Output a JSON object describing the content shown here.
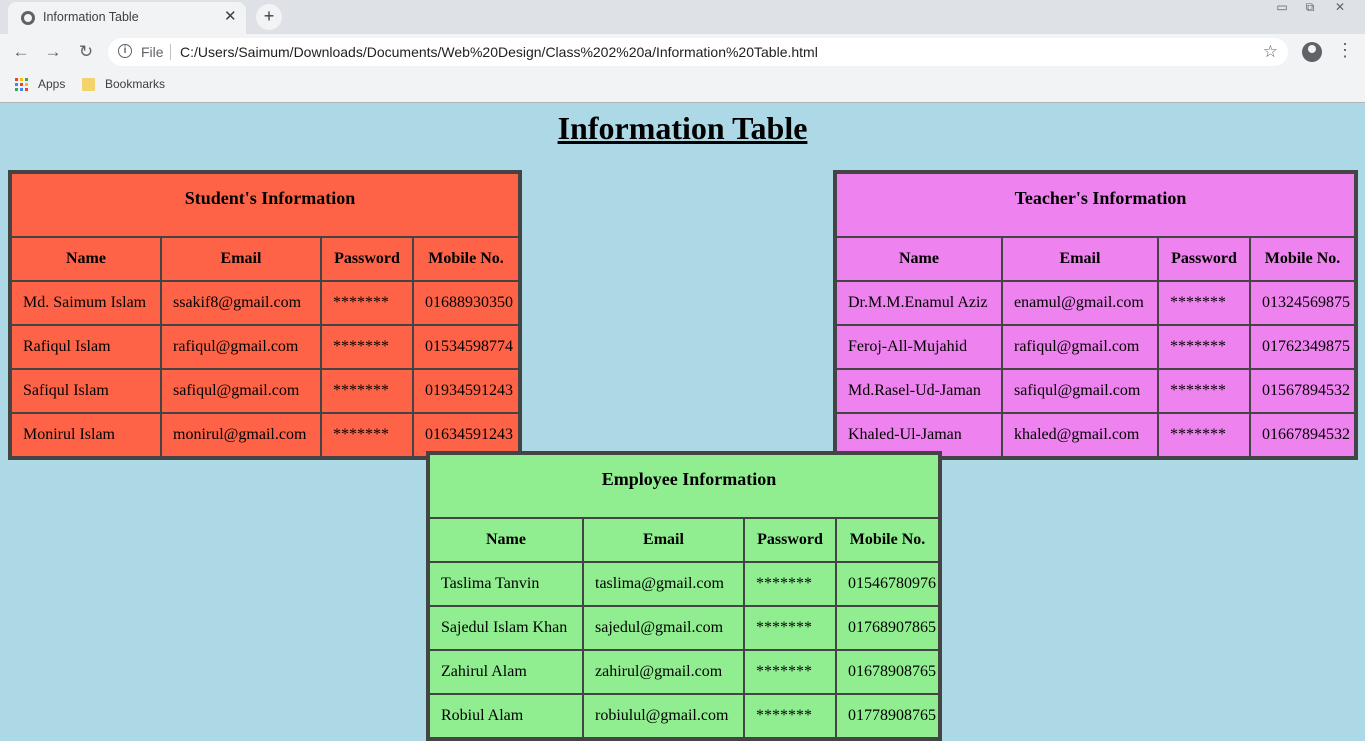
{
  "browser": {
    "tab_title": "Information Table",
    "tab_close": "✕",
    "new_tab": "+",
    "omnibox_scheme": "File",
    "url": "C:/Users/Saimum/Downloads/Documents/Web%20Design/Class%202%20a/Information%20Table.html",
    "bookmarks": [
      "Apps",
      "Bookmarks"
    ]
  },
  "page": {
    "title": "Information Table"
  },
  "headers": [
    "Name",
    "Email",
    "Password",
    "Mobile No."
  ],
  "students": {
    "caption": "Student's Information",
    "rows": [
      [
        "Md. Saimum Islam",
        "ssakif8@gmail.com",
        "*******",
        "01688930350"
      ],
      [
        "Rafiqul Islam",
        "rafiqul@gmail.com",
        "*******",
        "01534598774"
      ],
      [
        "Safiqul Islam",
        "safiqul@gmail.com",
        "*******",
        "01934591243"
      ],
      [
        "Monirul Islam",
        "monirul@gmail.com",
        "*******",
        "01634591243"
      ]
    ]
  },
  "teachers": {
    "caption": "Teacher's Information",
    "rows": [
      [
        "Dr.M.M.Enamul Aziz",
        "enamul@gmail.com",
        "*******",
        "01324569875"
      ],
      [
        "Feroj-All-Mujahid",
        "rafiqul@gmail.com",
        "*******",
        "01762349875"
      ],
      [
        "Md.Rasel-Ud-Jaman",
        "safiqul@gmail.com",
        "*******",
        "01567894532"
      ],
      [
        "Khaled-Ul-Jaman",
        "khaled@gmail.com",
        "*******",
        "01667894532"
      ]
    ]
  },
  "employees": {
    "caption": "Employee Information",
    "rows": [
      [
        "Taslima Tanvin",
        "taslima@gmail.com",
        "*******",
        "01546780976"
      ],
      [
        "Sajedul Islam Khan",
        "sajedul@gmail.com",
        "*******",
        "01768907865"
      ],
      [
        "Zahirul Alam",
        "zahirul@gmail.com",
        "*******",
        "01678908765"
      ],
      [
        "Robiul Alam",
        "robiulul@gmail.com",
        "*******",
        "01778908765"
      ]
    ]
  },
  "colors": {
    "page_bg": "#add8e6",
    "students_bg": "#ff6347",
    "teachers_bg": "#ee82ee",
    "employees_bg": "#90ee90"
  }
}
